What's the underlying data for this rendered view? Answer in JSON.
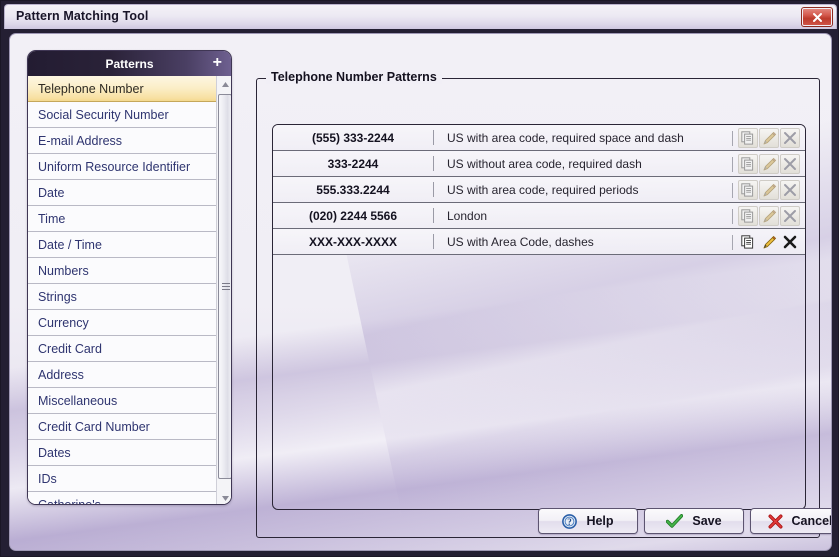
{
  "window": {
    "title": "Pattern Matching Tool",
    "close_icon": "close-icon"
  },
  "sidebar": {
    "header_title": "Patterns",
    "add_label": "+",
    "selected_index": 0,
    "items": [
      {
        "label": "Telephone Number"
      },
      {
        "label": "Social Security Number"
      },
      {
        "label": "E-mail Address"
      },
      {
        "label": "Uniform Resource Identifier"
      },
      {
        "label": "Date"
      },
      {
        "label": "Time"
      },
      {
        "label": "Date / Time"
      },
      {
        "label": "Numbers"
      },
      {
        "label": "Strings"
      },
      {
        "label": "Currency"
      },
      {
        "label": "Credit Card"
      },
      {
        "label": "Address"
      },
      {
        "label": "Miscellaneous"
      },
      {
        "label": "Credit Card Number"
      },
      {
        "label": "Dates"
      },
      {
        "label": "IDs"
      },
      {
        "label": "Catherine's"
      }
    ],
    "scrollbar": {
      "up_icon": "caret-up-icon",
      "down_icon": "caret-down-icon",
      "thumb_name": "scroll-thumb"
    }
  },
  "main": {
    "group_title": "Telephone Number Patterns",
    "row_action_icons": [
      "copy-icon",
      "edit-pencil-icon",
      "delete-x-icon"
    ],
    "rows": [
      {
        "example": "(555) 333-2244",
        "description": "US with area code, required space and dash",
        "active": false
      },
      {
        "example": "333-2244",
        "description": "US without area code, required dash",
        "active": false
      },
      {
        "example": "555.333.2244",
        "description": "US with area code, required periods",
        "active": false
      },
      {
        "example": "(020) 2244 5566",
        "description": "London",
        "active": false
      },
      {
        "example": "XXX-XXX-XXXX",
        "description": "US with Area Code, dashes",
        "active": true
      }
    ]
  },
  "footer": {
    "help_label": "Help",
    "save_label": "Save",
    "cancel_label": "Cancel",
    "help_icon": "question-circle-icon",
    "save_icon": "check-icon",
    "cancel_icon": "x-icon"
  },
  "colors": {
    "accent_purple": "#6e6090",
    "header_dark": "#231c32",
    "selected_row": "#fbeec7",
    "link_text": "#2f3570",
    "close_red": "#bc3a2c",
    "save_green": "#2f9b34",
    "cancel_red": "#cc2222",
    "help_blue": "#2a5fa8"
  }
}
